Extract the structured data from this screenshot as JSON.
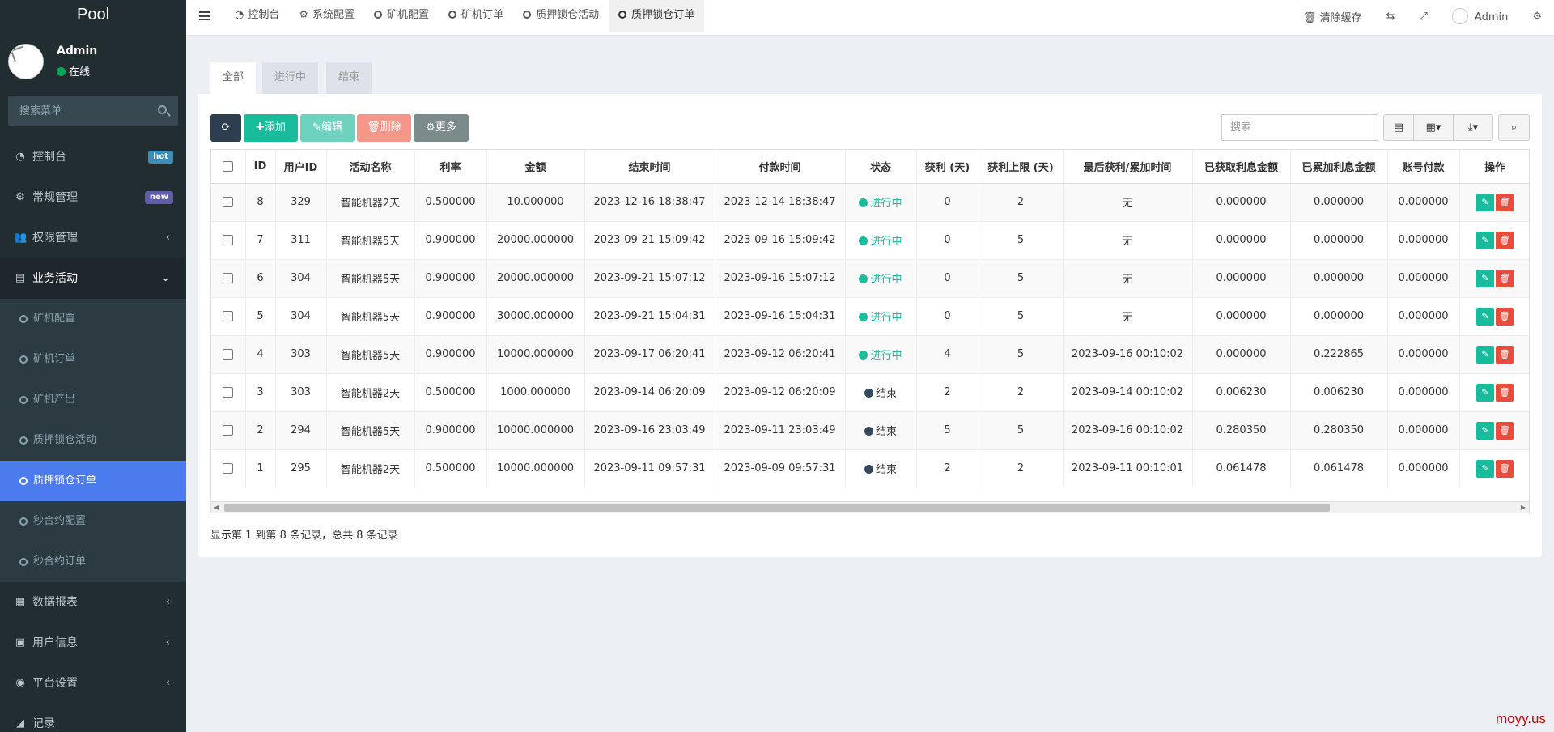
{
  "sidebar": {
    "logo": "Pool",
    "user": {
      "name": "Admin",
      "status": "在线"
    },
    "search_placeholder": "搜索菜单",
    "menu": [
      {
        "label": "控制台",
        "icon": "dashboard-icon",
        "icon_char": "◔",
        "badge": "hot",
        "badge_color": "#3c8dbc"
      },
      {
        "label": "常规管理",
        "icon": "cogs-icon",
        "icon_char": "⚙",
        "badge": "new",
        "badge_color": "#605ca8"
      },
      {
        "label": "权限管理",
        "icon": "group-icon",
        "icon_char": "👥",
        "chevron": "‹"
      },
      {
        "label": "业务活动",
        "icon": "list-alt-icon",
        "icon_char": "▤",
        "chevron": "⌄"
      }
    ],
    "submenu": [
      {
        "label": "矿机配置"
      },
      {
        "label": "矿机订单"
      },
      {
        "label": "矿机产出"
      },
      {
        "label": "质押锁仓活动"
      },
      {
        "label": "质押锁仓订单",
        "active": true
      },
      {
        "label": "秒合约配置"
      },
      {
        "label": "秒合约订单"
      }
    ],
    "menu_bottom": [
      {
        "label": "数据报表",
        "icon": "file-text-icon",
        "icon_char": "▦",
        "chevron": "‹"
      },
      {
        "label": "用户信息",
        "icon": "address-book-icon",
        "icon_char": "▣",
        "chevron": "‹"
      },
      {
        "label": "平台设置",
        "icon": "dot-circle-icon",
        "icon_char": "◉",
        "chevron": "‹"
      },
      {
        "label": "记录",
        "icon": "chart-icon",
        "icon_char": "◢"
      }
    ]
  },
  "topbar": {
    "tabs": [
      {
        "label": "控制台",
        "icon": "dashboard-icon",
        "icon_char": "◔"
      },
      {
        "label": "系统配置",
        "icon": "gear-icon",
        "icon_char": "⚙"
      },
      {
        "label": "矿机配置"
      },
      {
        "label": "矿机订单"
      },
      {
        "label": "质押锁仓活动"
      },
      {
        "label": "质押锁仓订单",
        "active": true
      }
    ],
    "clear_cache": "清除缓存",
    "user": "Admin"
  },
  "content": {
    "filter_tabs": [
      "全部",
      "进行中",
      "结束"
    ],
    "toolbar": {
      "add": "添加",
      "edit": "编辑",
      "delete": "删除",
      "more": "更多"
    },
    "search_placeholder": "搜索",
    "columns": [
      "ID",
      "用户ID",
      "活动名称",
      "利率",
      "金额",
      "结束时间",
      "付款时间",
      "状态",
      "获利 (天)",
      "获利上限 (天)",
      "最后获利/累加时间",
      "已获取利息金额",
      "已累加利息金额",
      "账号付款",
      "操作"
    ],
    "rows": [
      {
        "id": "8",
        "uid": "329",
        "name": "智能机器2天",
        "rate": "0.500000",
        "amount": "10.000000",
        "end": "2023-12-16 18:38:47",
        "pay": "2023-12-14 18:38:47",
        "status": "进行中",
        "running": true,
        "days": "0",
        "limit": "2",
        "last": "无",
        "got": "0.000000",
        "acc": "0.000000",
        "acct": "0.000000"
      },
      {
        "id": "7",
        "uid": "311",
        "name": "智能机器5天",
        "rate": "0.900000",
        "amount": "20000.000000",
        "end": "2023-09-21 15:09:42",
        "pay": "2023-09-16 15:09:42",
        "status": "进行中",
        "running": true,
        "days": "0",
        "limit": "5",
        "last": "无",
        "got": "0.000000",
        "acc": "0.000000",
        "acct": "0.000000"
      },
      {
        "id": "6",
        "uid": "304",
        "name": "智能机器5天",
        "rate": "0.900000",
        "amount": "20000.000000",
        "end": "2023-09-21 15:07:12",
        "pay": "2023-09-16 15:07:12",
        "status": "进行中",
        "running": true,
        "days": "0",
        "limit": "5",
        "last": "无",
        "got": "0.000000",
        "acc": "0.000000",
        "acct": "0.000000"
      },
      {
        "id": "5",
        "uid": "304",
        "name": "智能机器5天",
        "rate": "0.900000",
        "amount": "30000.000000",
        "end": "2023-09-21 15:04:31",
        "pay": "2023-09-16 15:04:31",
        "status": "进行中",
        "running": true,
        "days": "0",
        "limit": "5",
        "last": "无",
        "got": "0.000000",
        "acc": "0.000000",
        "acct": "0.000000"
      },
      {
        "id": "4",
        "uid": "303",
        "name": "智能机器5天",
        "rate": "0.900000",
        "amount": "10000.000000",
        "end": "2023-09-17 06:20:41",
        "pay": "2023-09-12 06:20:41",
        "status": "进行中",
        "running": true,
        "days": "4",
        "limit": "5",
        "last": "2023-09-16 00:10:02",
        "got": "0.000000",
        "acc": "0.222865",
        "acct": "0.000000"
      },
      {
        "id": "3",
        "uid": "303",
        "name": "智能机器2天",
        "rate": "0.500000",
        "amount": "1000.000000",
        "end": "2023-09-14 06:20:09",
        "pay": "2023-09-12 06:20:09",
        "status": "结束",
        "running": false,
        "days": "2",
        "limit": "2",
        "last": "2023-09-14 00:10:02",
        "got": "0.006230",
        "acc": "0.006230",
        "acct": "0.000000"
      },
      {
        "id": "2",
        "uid": "294",
        "name": "智能机器5天",
        "rate": "0.900000",
        "amount": "10000.000000",
        "end": "2023-09-16 23:03:49",
        "pay": "2023-09-11 23:03:49",
        "status": "结束",
        "running": false,
        "days": "5",
        "limit": "5",
        "last": "2023-09-16 00:10:02",
        "got": "0.280350",
        "acc": "0.280350",
        "acct": "0.000000"
      },
      {
        "id": "1",
        "uid": "295",
        "name": "智能机器2天",
        "rate": "0.500000",
        "amount": "10000.000000",
        "end": "2023-09-11 09:57:31",
        "pay": "2023-09-09 09:57:31",
        "status": "结束",
        "running": false,
        "days": "2",
        "limit": "2",
        "last": "2023-09-11 00:10:01",
        "got": "0.061478",
        "acc": "0.061478",
        "acct": "0.000000"
      }
    ],
    "page_info": "显示第 1 到第 8 条记录，总共 8 条记录"
  },
  "watermark": "moyy.us",
  "colors": {
    "sidebar_bg": "#222d32",
    "active": "#4c7bee",
    "success": "#18bc9c",
    "danger": "#e74c3c",
    "end_dot": "#34495e"
  }
}
